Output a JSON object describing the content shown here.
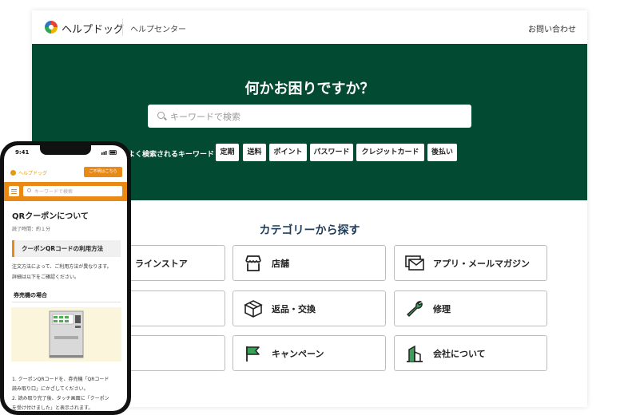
{
  "brand": {
    "name": "ヘルプドッグ",
    "subtitle": "ヘルプセンター"
  },
  "header": {
    "contact_label": "お問い合わせ"
  },
  "hero": {
    "title": "何かお困りですか？",
    "search_placeholder": "キーワードで検索",
    "keywords_label": "よく検索されるキーワード",
    "keywords": [
      "定期",
      "送料",
      "ポイント",
      "パスワード",
      "クレジットカード",
      "後払い"
    ]
  },
  "categories": {
    "title": "カテゴリーから探す",
    "items": [
      {
        "label": "オンラインストア",
        "icon": "cart-icon",
        "visible_text": "ラインストア"
      },
      {
        "label": "店舗",
        "icon": "storefront-icon"
      },
      {
        "label": "アプリ・メールマガジン",
        "icon": "envelope-icon"
      },
      {
        "label": "",
        "icon": ""
      },
      {
        "label": "返品・交換",
        "icon": "box-icon"
      },
      {
        "label": "修理",
        "icon": "wrench-icon"
      },
      {
        "label": "",
        "icon": ""
      },
      {
        "label": "キャンペーン",
        "icon": "flag-icon"
      },
      {
        "label": "会社について",
        "icon": "building-icon"
      }
    ]
  },
  "phone": {
    "time": "9:41",
    "brand": "ヘルプドッグ",
    "contact_button": "ご不明はこちら",
    "search_placeholder": "キーワードで検索",
    "article_title": "QRクーポンについて",
    "read_time": "読了時間：約１分",
    "section_title": "クーポンQRコードの利用方法",
    "section_body": [
      "注文方法によって、ご利用方法が異なります。",
      "詳細は以下をご確認ください。"
    ],
    "subsection_title": "券売機の場合",
    "steps": [
      "1. クーポンQRコードを、券売機「QRコード",
      "    読み取り口」にかざしてください。",
      "2. 読み取り完了後、タッチ画面に「クーポン",
      "    を受け付けました」と表示されます。"
    ]
  },
  "colors": {
    "hero_green": "#034a33",
    "accent_orange": "#ea8a16",
    "heading_navy": "#1f3c5a"
  }
}
